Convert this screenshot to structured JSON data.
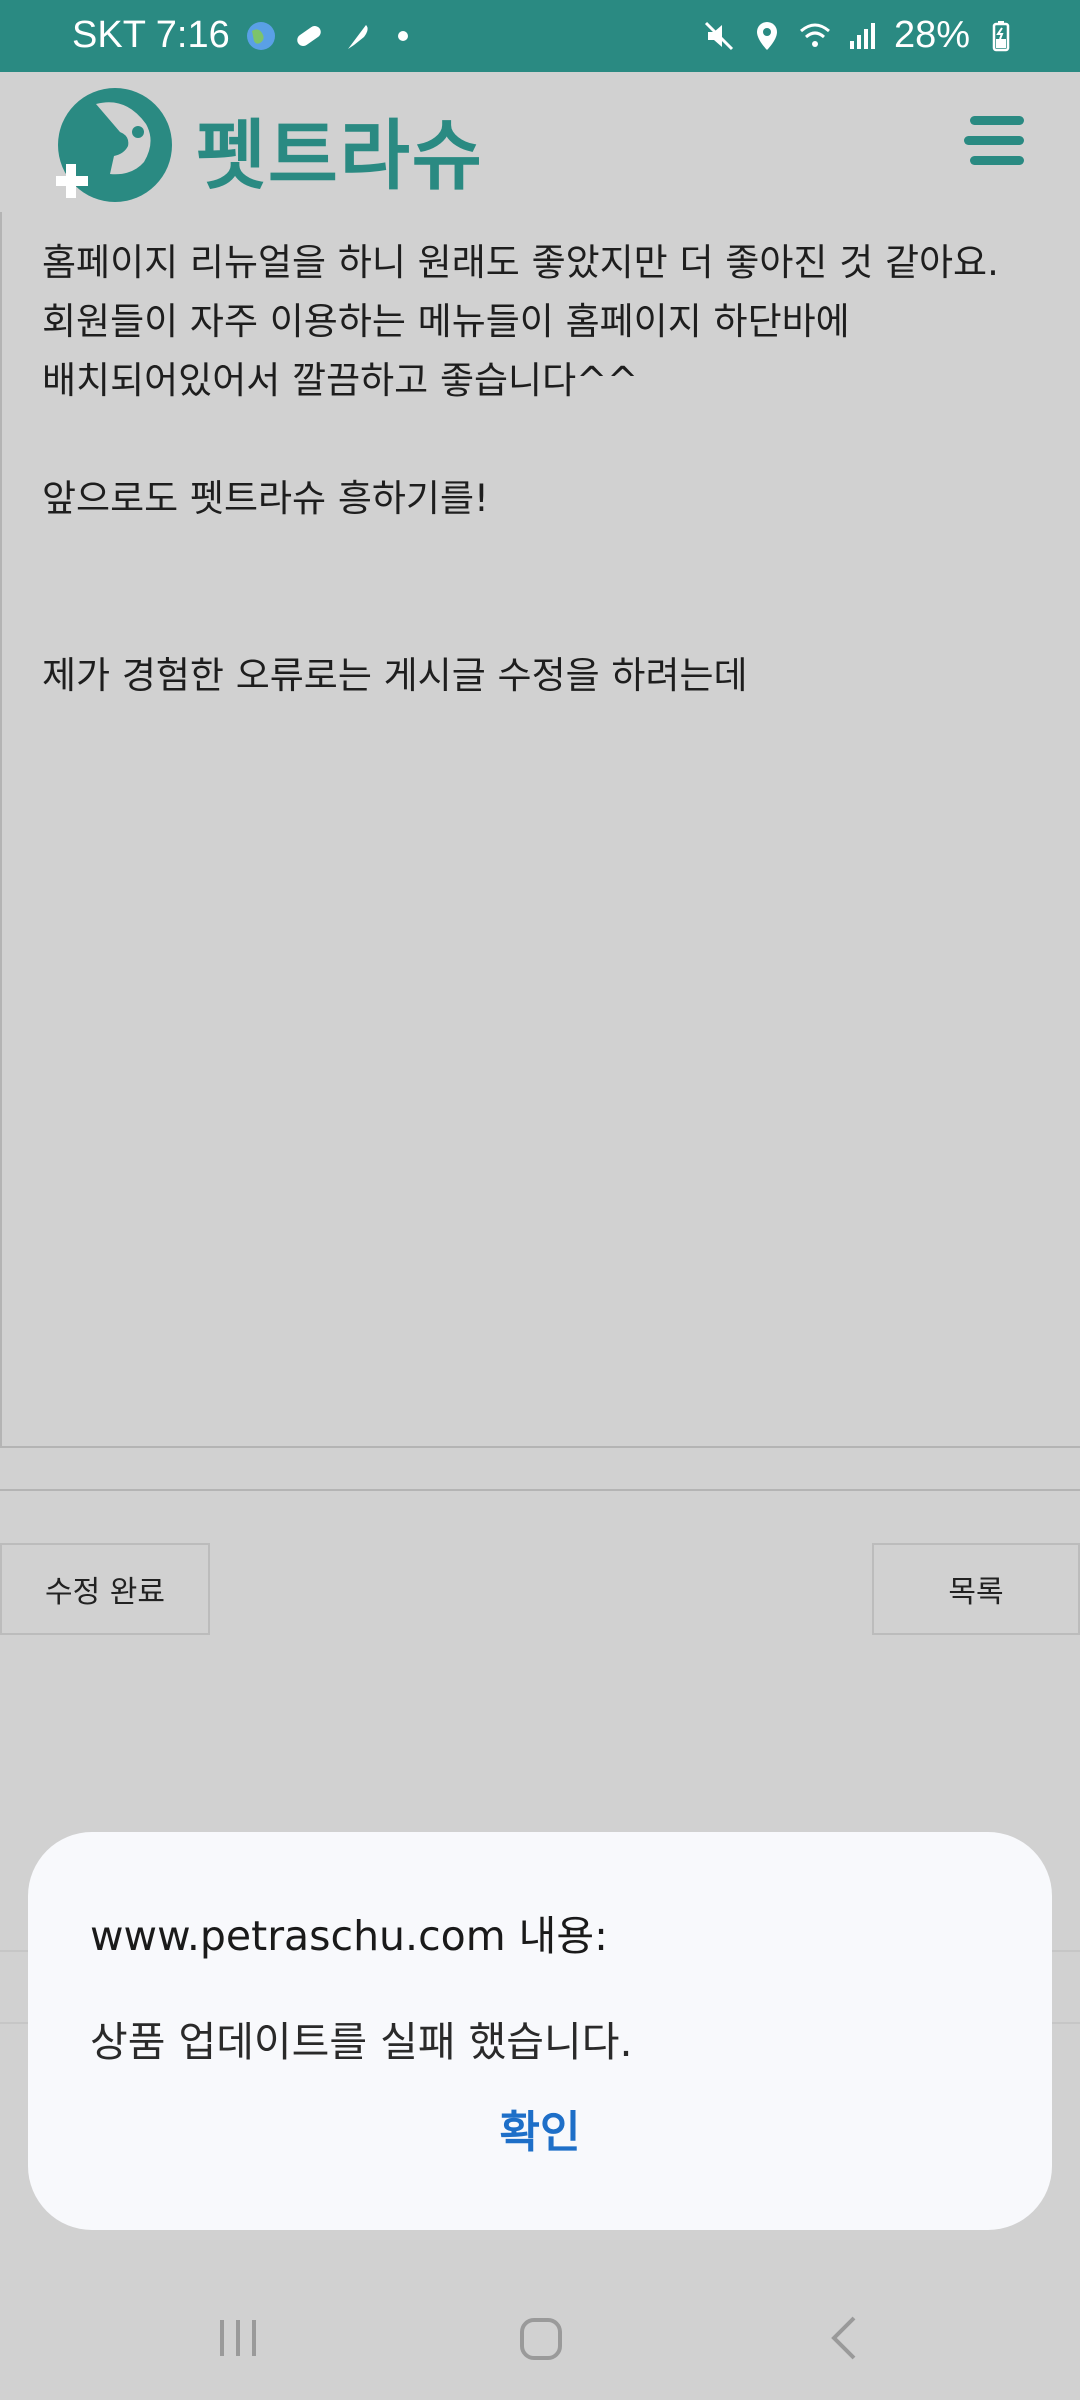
{
  "status_bar": {
    "carrier_time": "SKT 7:16",
    "battery": "28%",
    "icons": [
      "globe-icon",
      "pill-icon",
      "feather-icon",
      "notification-dot",
      "mute-icon",
      "location-icon",
      "wifi-icon",
      "signal-icon",
      "battery-charging-icon"
    ]
  },
  "header": {
    "logo_text": "펫트라슈",
    "logo_icon": "dog-medical-logo",
    "menu_icon": "hamburger-icon"
  },
  "editor": {
    "lines": [
      "홈페이지 리뉴얼을 하니 원래도 좋았지만 더 좋아진 것 같아요.",
      "회원들이 자주 이용하는 메뉴들이 홈페이지 하단바에",
      "배치되어있어서 깔끔하고 좋습니다^^",
      "",
      "앞으로도 펫트라슈 흥하기를!",
      "",
      "",
      "제가 경험한 오류로는 게시글 수정을 하려는데"
    ]
  },
  "buttons": {
    "save_label": "수정 완료",
    "list_label": "목록"
  },
  "dialog": {
    "title": "www.petraschu.com 내용:",
    "message": "상품 업데이트를 실패 했습니다.",
    "ok_label": "확인"
  },
  "nav_bar": {
    "icons": [
      "recent-apps-icon",
      "home-icon",
      "back-icon"
    ]
  },
  "colors": {
    "brand": "#2a8a82",
    "dialog_button": "#1e6fc8",
    "overlay_background": "#d1d1d1"
  }
}
